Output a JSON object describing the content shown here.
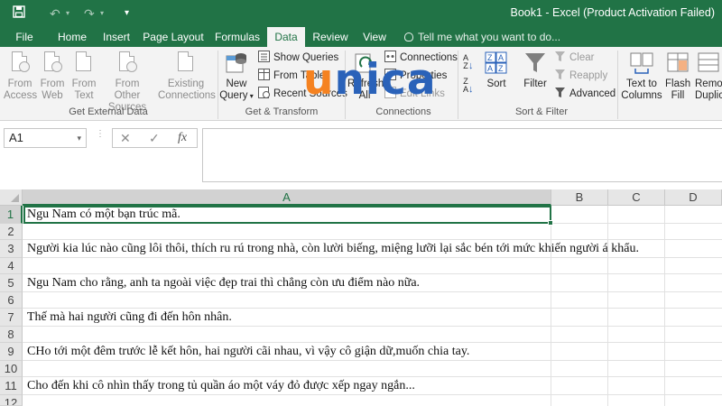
{
  "window": {
    "title": "Book1 - Excel (Product Activation Failed)"
  },
  "tabs": [
    {
      "label": "File"
    },
    {
      "label": "Home"
    },
    {
      "label": "Insert"
    },
    {
      "label": "Page Layout"
    },
    {
      "label": "Formulas"
    },
    {
      "label": "Data"
    },
    {
      "label": "Review"
    },
    {
      "label": "View"
    }
  ],
  "active_tab": "Data",
  "tell_me": "Tell me what you want to do...",
  "ribbon": {
    "get_external_data": {
      "label": "Get External Data",
      "from_access": "From Access",
      "from_web": "From Web",
      "from_text": "From Text",
      "from_other": "From Other Sources",
      "existing": "Existing Connections"
    },
    "get_transform": {
      "label": "Get & Transform",
      "new_query": "New Query",
      "show_queries": "Show Queries",
      "from_table": "From Table",
      "recent_sources": "Recent Sources"
    },
    "connections": {
      "label": "Connections",
      "refresh_all": "Refresh All",
      "connections": "Connections",
      "properties": "Properties",
      "edit_links": "Edit Links"
    },
    "sort_filter": {
      "label": "Sort & Filter",
      "sort": "Sort",
      "filter": "Filter",
      "clear": "Clear",
      "reapply": "Reapply",
      "advanced": "Advanced"
    },
    "data_tools": {
      "text_to_columns": "Text to Columns",
      "flash_fill": "Flash Fill",
      "remove_duplicates": "Remove Duplicates"
    }
  },
  "watermark": {
    "u": "u",
    "rest": "nica"
  },
  "formula_bar": {
    "name_box": "A1",
    "fx": "fx",
    "value": ""
  },
  "grid": {
    "columns": [
      "A",
      "B",
      "C",
      "D"
    ],
    "rows": [
      "1",
      "2",
      "3",
      "4",
      "5",
      "6",
      "7",
      "8",
      "9",
      "10",
      "11",
      "12"
    ],
    "cells": {
      "A1": "Ngu Nam có một bạn trúc mã.",
      "A3": "Người kia lúc nào cũng lôi thôi, thích ru rú trong nhà, còn lười biếng, miệng lưỡi lại sắc bén tới mức khiến người á khẩu.",
      "A5": "Ngu Nam cho rằng, anh ta ngoài việc đẹp trai thì chẳng còn ưu điểm nào nữa.",
      "A7": "Thế mà hai người cũng đi đến hôn nhân.",
      "A9": "CHo tới một đêm trước lễ kết hôn, hai người cãi nhau, vì vậy cô giận dữ,muốn chia tay.",
      "A11": "Cho đến khi cô nhìn thấy trong tủ quần áo một váy đỏ được xếp ngay ngắn..."
    }
  },
  "colors": {
    "excel_green": "#217346",
    "ribbon_bg": "#f3f3f3",
    "watermark_orange": "#f58220",
    "watermark_blue": "#2a62b9"
  }
}
